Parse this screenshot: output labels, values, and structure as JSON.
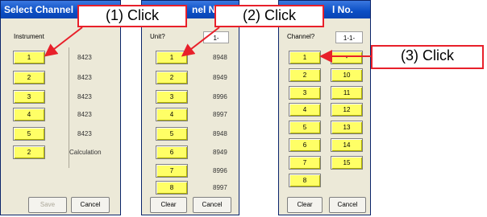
{
  "dialogs": [
    {
      "title": "Select Channel",
      "prompt": "Instrument",
      "rows": [
        {
          "button": "1",
          "value": "8423"
        },
        {
          "button": "2",
          "value": "8423"
        },
        {
          "button": "3",
          "value": "8423"
        },
        {
          "button": "4",
          "value": "8423"
        },
        {
          "button": "5",
          "value": "8423"
        },
        {
          "button": "2",
          "value": "Calculation"
        }
      ],
      "ok_label": "Save",
      "cancel_label": "Cancel"
    },
    {
      "title": "nel N",
      "prompt": "Unit?",
      "field_value": "1-",
      "rows": [
        {
          "button": "1",
          "value": "8948"
        },
        {
          "button": "2",
          "value": "8949"
        },
        {
          "button": "3",
          "value": "8996"
        },
        {
          "button": "4",
          "value": "8997"
        },
        {
          "button": "5",
          "value": "8948"
        },
        {
          "button": "6",
          "value": "8949"
        },
        {
          "button": "7",
          "value": "8996"
        },
        {
          "button": "8",
          "value": "8997"
        }
      ],
      "clear_label": "Clear",
      "cancel_label": "Cancel"
    },
    {
      "title": "l No.",
      "prompt": "Channel?",
      "field_value": "1-1-",
      "left_buttons": [
        "1",
        "2",
        "3",
        "4",
        "5",
        "6",
        "7",
        "8"
      ],
      "right_buttons": [
        "-",
        "10",
        "11",
        "12",
        "13",
        "14",
        "15"
      ],
      "clear_label": "Clear",
      "cancel_label": "Cancel"
    }
  ],
  "callouts": [
    "(1) Click",
    "(2) Click",
    "(3) Click"
  ],
  "colors": {
    "callout_border": "#e8202a",
    "button_fill": "#ffff66",
    "title_bar": "#0b4ec4"
  }
}
